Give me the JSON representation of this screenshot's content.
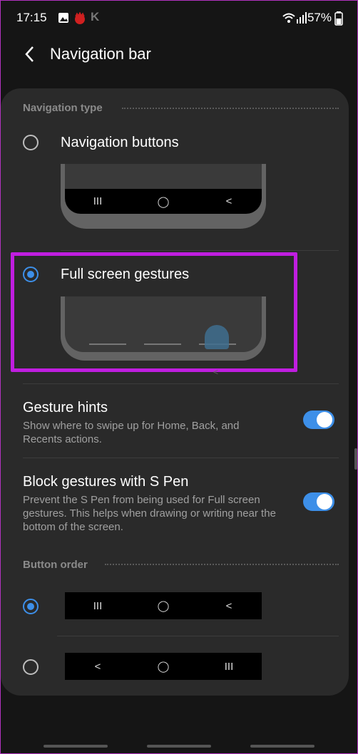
{
  "status_bar": {
    "time": "17:15",
    "left_icons": [
      "image-icon",
      "hedgehog-app-icon",
      "k-app-icon"
    ],
    "right_icons": [
      "wifi-icon",
      "signal-icon"
    ],
    "battery": "57%"
  },
  "header": {
    "title": "Navigation bar"
  },
  "navigation_type": {
    "section_label": "Navigation type",
    "options": [
      {
        "label": "Navigation buttons",
        "selected": false
      },
      {
        "label": "Full screen gestures",
        "selected": true
      }
    ]
  },
  "gesture_hints": {
    "title": "Gesture hints",
    "description": "Show where to swipe up for Home, Back, and Recents actions.",
    "enabled": true
  },
  "block_gestures": {
    "title": "Block gestures with S Pen",
    "description": "Prevent the S Pen from being used for Full screen gestures. This helps when drawing or writing near the bottom of the screen.",
    "enabled": true
  },
  "button_order": {
    "section_label": "Button order",
    "options": [
      {
        "glyphs": [
          "III",
          "O",
          "<"
        ],
        "selected": true
      },
      {
        "glyphs": [
          "<",
          "O",
          "III"
        ],
        "selected": false
      }
    ]
  },
  "colors": {
    "accent": "#3d8fe8",
    "highlight": "#c01ee0",
    "card": "#2a2a2a",
    "background": "#151515"
  }
}
